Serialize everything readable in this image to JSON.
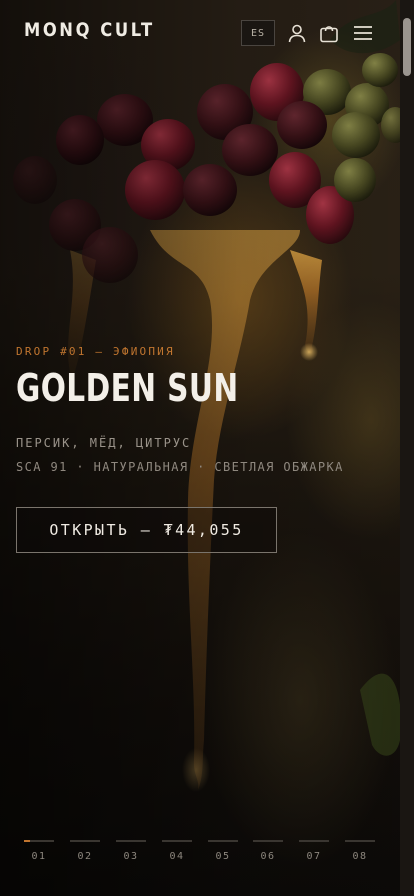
{
  "header": {
    "logo": "MONQ CULT",
    "language": "ES",
    "icons": [
      "user-icon",
      "cart-icon",
      "menu-icon"
    ]
  },
  "hero": {
    "eyebrow": "DROP #01 — ЭФИОПИЯ",
    "title": "GOLDEN SUN",
    "tasting_notes": "ПЕРСИК, МЁД, ЦИТРУС",
    "specs": "SCA 91 · НАТУРАЛЬНАЯ · СВЕТЛАЯ ОБЖАРКА",
    "cta_label": "ОТКРЫТЬ — ₮44,055"
  },
  "pager": {
    "items": [
      {
        "label": "01",
        "progress": 0.2
      },
      {
        "label": "02",
        "progress": 0
      },
      {
        "label": "03",
        "progress": 0
      },
      {
        "label": "04",
        "progress": 0
      },
      {
        "label": "05",
        "progress": 0
      },
      {
        "label": "06",
        "progress": 0
      },
      {
        "label": "07",
        "progress": 0
      },
      {
        "label": "08",
        "progress": 0
      }
    ]
  },
  "colors": {
    "accent": "#c0752f",
    "text": "#f0ebe3",
    "muted": "#9a938a",
    "background": "#0d0b09"
  }
}
